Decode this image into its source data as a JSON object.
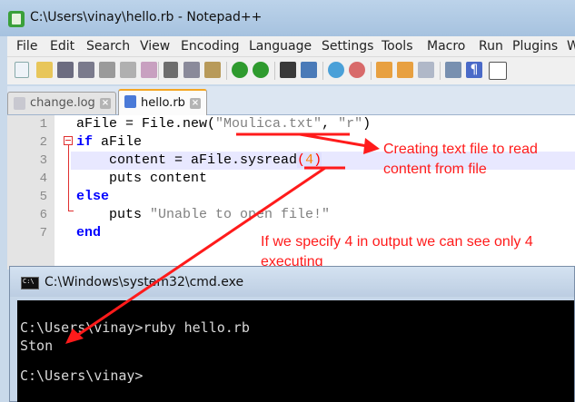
{
  "window": {
    "title": "C:\\Users\\vinay\\hello.rb - Notepad++"
  },
  "menu": [
    "File",
    "Edit",
    "Search",
    "View",
    "Encoding",
    "Language",
    "Settings",
    "Tools",
    "Macro",
    "Run",
    "Plugins",
    "W"
  ],
  "toolbar": {
    "buttons": [
      "new-file-icon",
      "open-file-icon",
      "save-icon",
      "save-all-icon",
      "close-icon",
      "close-all-icon",
      "print-icon",
      "cut-icon",
      "copy-icon",
      "paste-icon",
      "undo-icon",
      "redo-icon",
      "find-icon",
      "replace-icon",
      "zoom-in-icon",
      "zoom-out-icon",
      "sync-vertical-icon",
      "sync-horizontal-icon",
      "word-wrap-icon",
      "show-all-chars-icon",
      "indent-guide-icon"
    ]
  },
  "tabs": [
    {
      "label": "change.log",
      "active": false
    },
    {
      "label": "hello.rb",
      "active": true
    }
  ],
  "editor": {
    "line_numbers": [
      "1",
      "2",
      "3",
      "4",
      "5",
      "6",
      "7"
    ],
    "lines": [
      {
        "t1": "aFile = File.new(",
        "s1": "\"Moulica.txt\"",
        "t2": ", ",
        "s2": "\"r\"",
        "t3": ")"
      },
      {
        "k1": "if",
        "t1": " aFile"
      },
      {
        "t1": "    content = aFile.sysread",
        "b1": "(",
        "n1": "4",
        "b2": ")"
      },
      {
        "t1": "    puts content"
      },
      {
        "k1": "else"
      },
      {
        "t1": "    puts ",
        "s1": "\"Unable to open file!\""
      },
      {
        "k1": "end"
      }
    ]
  },
  "annotations": {
    "note1_line1": "Creating text file to read",
    "note1_line2": "content from file",
    "note2_line1": "If we specify 4 in output we can see only 4",
    "note2_line2": "executing",
    "color": "#ff1b1b"
  },
  "cmd": {
    "title": "C:\\Windows\\system32\\cmd.exe",
    "lines": [
      "",
      "C:\\Users\\vinay>ruby hello.rb",
      "Ston",
      "",
      "C:\\Users\\vinay>"
    ]
  }
}
